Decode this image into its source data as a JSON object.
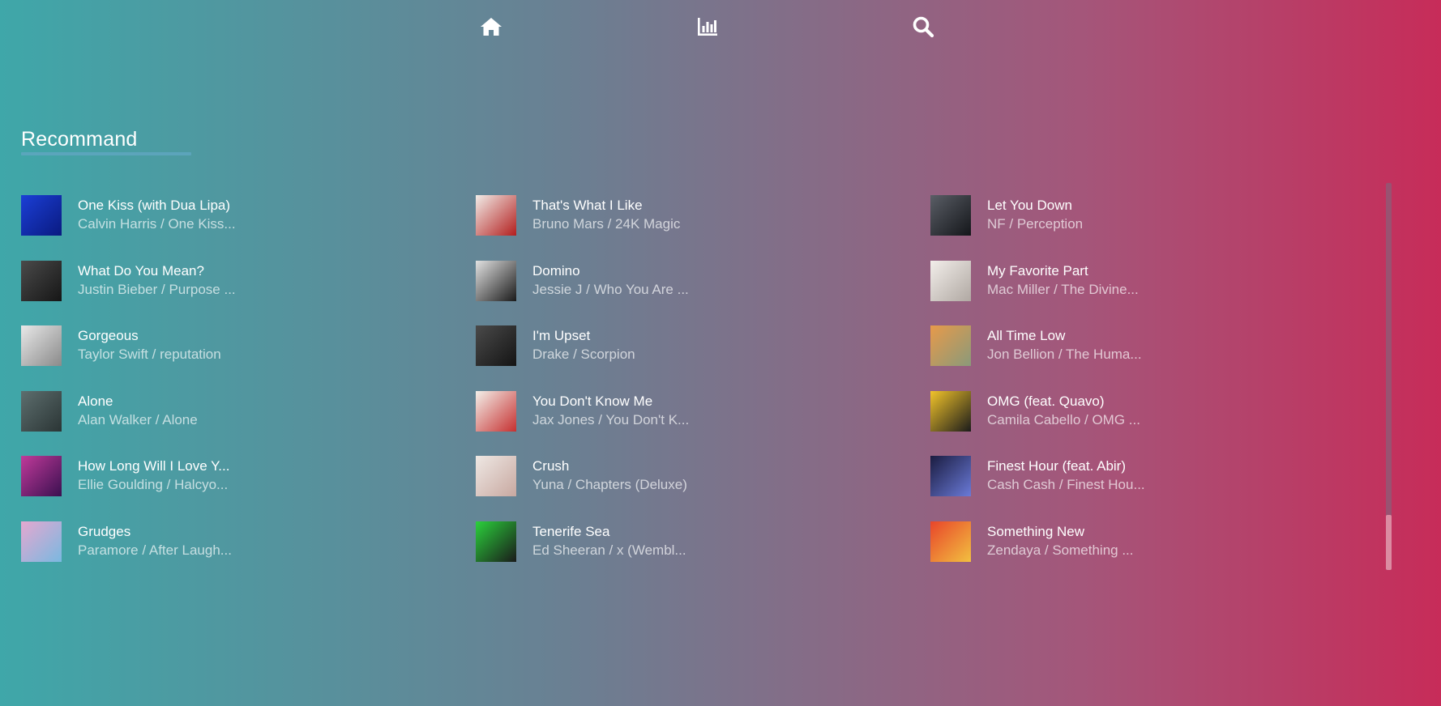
{
  "nav": {
    "home_icon": "home-icon",
    "charts_icon": "bar-chart-icon",
    "search_icon": "search-icon"
  },
  "section": {
    "title": "Recommand"
  },
  "columns": [
    [
      {
        "title": "One Kiss (with Dua Lipa)",
        "subtitle": "Calvin Harris / One Kiss...",
        "cover": [
          "#1b3fd6",
          "#0a1a80"
        ]
      },
      {
        "title": "What Do You Mean?",
        "subtitle": "Justin Bieber / Purpose ...",
        "cover": [
          "#4a4a4a",
          "#161616"
        ]
      },
      {
        "title": "Gorgeous",
        "subtitle": "Taylor Swift / reputation",
        "cover": [
          "#e8e8e8",
          "#8a8a8a"
        ]
      },
      {
        "title": "Alone",
        "subtitle": "Alan Walker / Alone",
        "cover": [
          "#5d6e6e",
          "#2b3535"
        ]
      },
      {
        "title": "How Long Will I Love Y...",
        "subtitle": "Ellie Goulding / Halcyo...",
        "cover": [
          "#c03a9a",
          "#3a1050"
        ]
      },
      {
        "title": "Grudges",
        "subtitle": "Paramore / After Laugh...",
        "cover": [
          "#e4a8d0",
          "#7ab8e0"
        ]
      }
    ],
    [
      {
        "title": "That's What I Like",
        "subtitle": "Bruno Mars / 24K Magic",
        "cover": [
          "#f1ede8",
          "#b31e1e"
        ]
      },
      {
        "title": "Domino",
        "subtitle": "Jessie J / Who You Are ...",
        "cover": [
          "#e2e2e2",
          "#1a1a1a"
        ]
      },
      {
        "title": "I'm Upset",
        "subtitle": "Drake / Scorpion",
        "cover": [
          "#4a4a4a",
          "#141414"
        ]
      },
      {
        "title": "You Don't Know Me",
        "subtitle": "Jax Jones / You Don't K...",
        "cover": [
          "#f3f0ea",
          "#c63030"
        ]
      },
      {
        "title": "Crush",
        "subtitle": "Yuna / Chapters (Deluxe)",
        "cover": [
          "#eee8e4",
          "#c8a8a0"
        ]
      },
      {
        "title": "Tenerife Sea",
        "subtitle": "Ed Sheeran / x (Wembl...",
        "cover": [
          "#2bd13c",
          "#1a1a1a"
        ]
      }
    ],
    [
      {
        "title": "Let You Down",
        "subtitle": "NF / Perception",
        "cover": [
          "#5a5e66",
          "#14161a"
        ]
      },
      {
        "title": "My Favorite Part",
        "subtitle": "Mac Miller / The Divine...",
        "cover": [
          "#f2eeea",
          "#b0a8a2"
        ]
      },
      {
        "title": "All Time Low",
        "subtitle": "Jon Bellion / The Huma...",
        "cover": [
          "#e79a4a",
          "#8a9a7a"
        ]
      },
      {
        "title": "OMG (feat. Quavo)",
        "subtitle": "Camila Cabello / OMG ...",
        "cover": [
          "#f2c42a",
          "#1b1b1b"
        ]
      },
      {
        "title": "Finest Hour (feat. Abir)",
        "subtitle": "Cash Cash / Finest Hou...",
        "cover": [
          "#1a1c40",
          "#6a7ad8"
        ]
      },
      {
        "title": "Something New",
        "subtitle": "Zendaya / Something ...",
        "cover": [
          "#e8452a",
          "#f2c040"
        ]
      }
    ]
  ],
  "scroll": {
    "thumb_position": 0.86
  }
}
